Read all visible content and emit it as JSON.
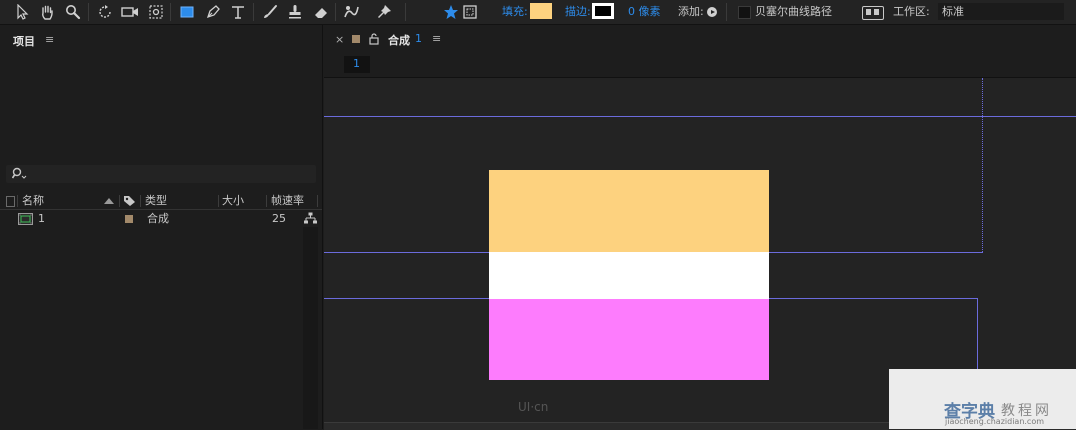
{
  "toolbar": {
    "fill_label": "填充:",
    "fill_color": "#fdd27f",
    "stroke_label": "描边:",
    "stroke_width": "0 像素",
    "add_label": "添加:",
    "bezier_label": "贝塞尔曲线路径",
    "workspace_label": "工作区:",
    "workspace_value": "标准",
    "accent_color": "#2d8ceb"
  },
  "project": {
    "title": "项目",
    "columns": [
      "名称",
      "类型",
      "大小",
      "帧速率"
    ],
    "items": [
      {
        "name": "1",
        "type": "合成",
        "size": "",
        "fps": "25",
        "label_color": "#a2896a"
      }
    ]
  },
  "composition": {
    "tab_label": "合成",
    "tab_comp_name": "1",
    "breadcrumb": "1",
    "layers": [
      {
        "name": "yellow-band",
        "color": "#fdd27f"
      },
      {
        "name": "white-band",
        "color": "#ffffff"
      },
      {
        "name": "pink-band",
        "color": "#fd7cfd"
      }
    ]
  },
  "watermark": {
    "logo_text": "UI·cn",
    "site_name": "查字典",
    "site_sub": "教程网",
    "site_url": "jiaocheng.chazidian.com"
  }
}
